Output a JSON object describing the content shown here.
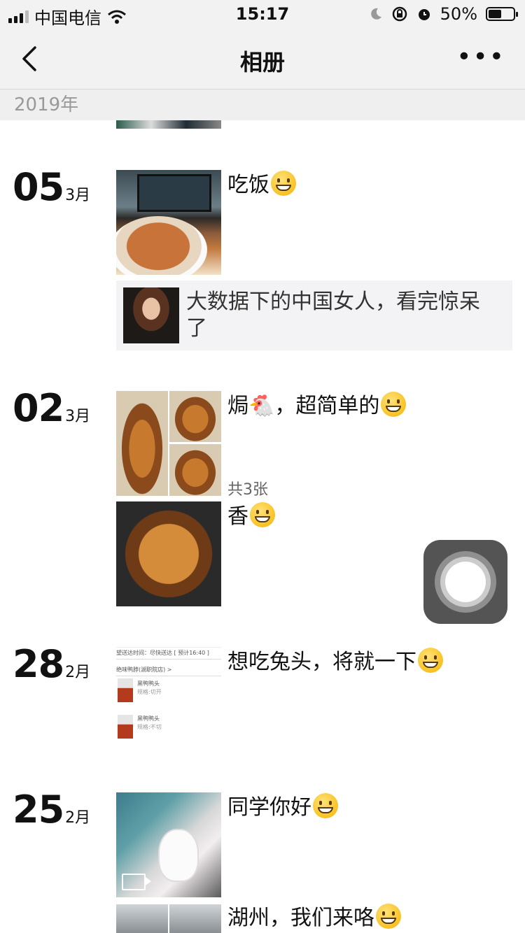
{
  "status_bar": {
    "carrier": "中国电信",
    "time": "15:17",
    "battery": "50%"
  },
  "nav": {
    "title": "相册"
  },
  "year_header": "2019年",
  "posts": [
    {
      "day": "05",
      "month": "3月",
      "caption": "吃饭",
      "shared_link": {
        "title": "大数据下的中国女人，看完惊呆了"
      }
    },
    {
      "day": "02",
      "month": "3月",
      "caption": "焗",
      "caption_suffix": "，超简单的",
      "photo_count": "共3张",
      "second_caption": "香"
    },
    {
      "day": "28",
      "month": "2月",
      "caption": "想吃兔头，将就一下",
      "screenshot": {
        "line1": "望送达时间：尽快送达 [ 预计16:40 ]",
        "shop": "绝味鸭脖(湖职院店) >",
        "item1": "黑鸭鸭头",
        "item1_spec": "规格:切开",
        "item2": "黑鸭鸭头",
        "item2_spec": "规格:不切"
      }
    },
    {
      "day": "25",
      "month": "2月",
      "caption": "同学你好",
      "second_caption": "湖州，我们来咯"
    }
  ],
  "icons": [
    "signal-icon",
    "wifi-icon",
    "moon-icon",
    "orientation-lock-icon",
    "alarm-icon",
    "battery-icon",
    "back-chevron-icon",
    "more-icon",
    "assistive-touch-icon",
    "video-icon"
  ]
}
